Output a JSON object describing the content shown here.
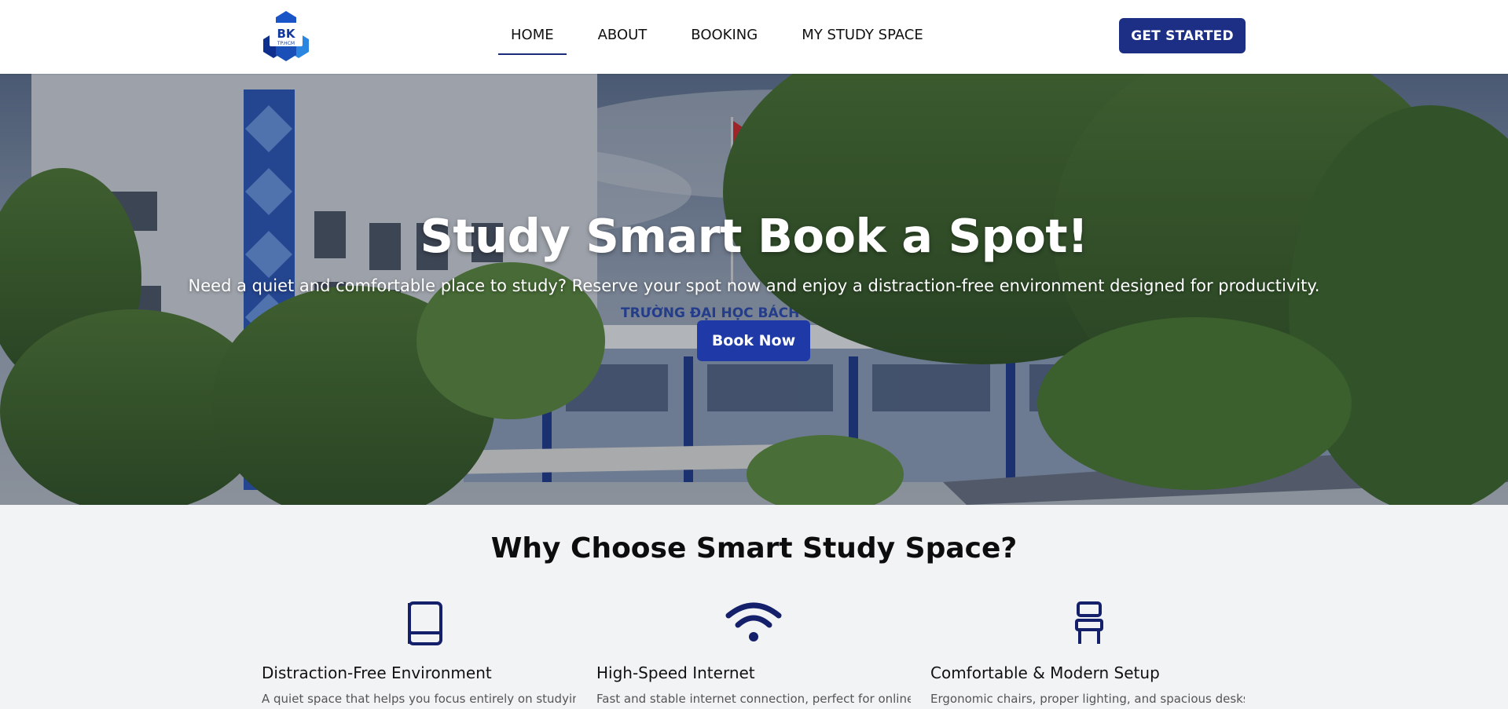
{
  "header": {
    "logo_text": "BK",
    "logo_subtext": "TP.HCM",
    "nav": [
      {
        "label": "HOME",
        "active": true
      },
      {
        "label": "ABOUT",
        "active": false
      },
      {
        "label": "BOOKING",
        "active": false
      },
      {
        "label": "MY STUDY SPACE",
        "active": false
      }
    ],
    "cta_label": "GET STARTED"
  },
  "hero": {
    "title": "Study Smart Book a Spot!",
    "subtitle": "Need a quiet and comfortable place to study? Reserve your spot now and enjoy a distraction-free environment designed for productivity.",
    "button_label": "Book Now",
    "building_sign": "TRƯỜNG ĐẠI HỌC BÁCH KHOA"
  },
  "features": {
    "heading": "Why Choose Smart Study Space?",
    "items": [
      {
        "icon": "book-icon",
        "title": "Distraction-Free Environment",
        "description": "A quiet space that helps you focus entirely on studying"
      },
      {
        "icon": "wifi-icon",
        "title": "High-Speed Internet",
        "description": "Fast and stable internet connection, perfect for online"
      },
      {
        "icon": "chair-icon",
        "title": "Comfortable & Modern Setup",
        "description": "Ergonomic chairs, proper lighting, and spacious desks"
      }
    ]
  },
  "colors": {
    "brand_navy": "#1c2f84",
    "button_blue": "#1f3aa6",
    "icon_navy": "#15206b",
    "section_bg": "#f2f3f5"
  }
}
